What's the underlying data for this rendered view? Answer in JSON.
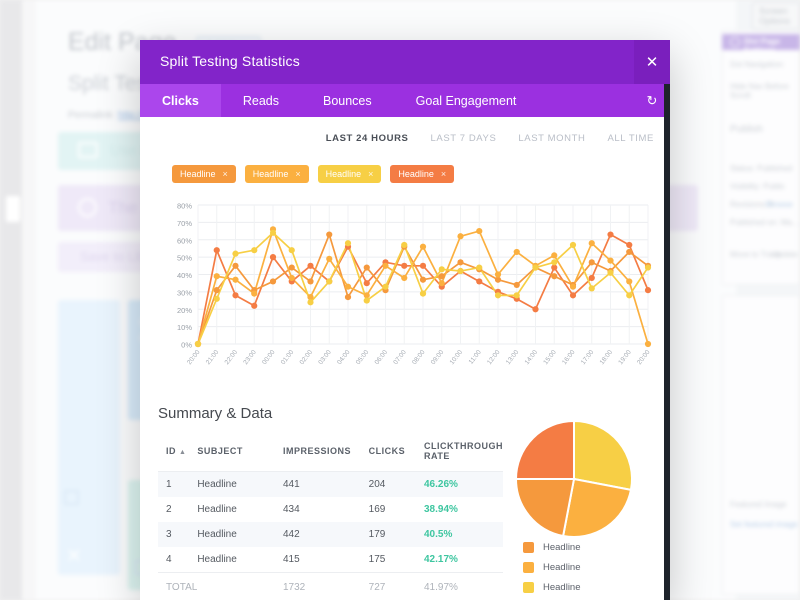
{
  "background": {
    "page_title": "Edit Page",
    "add_new": "Add New",
    "post_title": "Split Test",
    "permalink_label": "Permalink:",
    "permalink_url": "http://10.1.10.10:8888/",
    "use_default_editor": "Use Default Editor",
    "divi_builder": "The Divi Builder",
    "save_to_library": "Save to Library",
    "add_new_module": "Add New",
    "screen_options": "Screen Options",
    "divi_page_settings": "Divi Page Settings",
    "dot_navigation": "Dot Navigation:",
    "hide_nav_before_scroll": "Hide Nav Before Scroll:",
    "publish": "Publish",
    "status_published": "Status: Published",
    "visibility_public": "Visibility: Public",
    "revisions": "Revisions: 8",
    "revisions_link": "Browse",
    "published_on": "Published on: Ma...",
    "move_to_trash": "Move to Trash",
    "update": "Update",
    "featured_image": "Featured Image",
    "set_featured_image": "Set featured image"
  },
  "modal": {
    "title": "Split Testing Statistics",
    "close_icon": "close-icon",
    "refresh_icon": "refresh-icon",
    "tabs": [
      {
        "label": "Clicks",
        "active": true
      },
      {
        "label": "Reads",
        "active": false
      },
      {
        "label": "Bounces",
        "active": false
      },
      {
        "label": "Goal Engagement",
        "active": false
      }
    ],
    "ranges": [
      {
        "label": "LAST 24 HOURS",
        "active": true
      },
      {
        "label": "LAST 7 DAYS",
        "active": false
      },
      {
        "label": "LAST MONTH",
        "active": false
      },
      {
        "label": "ALL TIME",
        "active": false
      }
    ],
    "tags": [
      {
        "label": "Headline",
        "color": "#f5993d",
        "close": "×"
      },
      {
        "label": "Headline",
        "color": "#fbb040",
        "close": "×"
      },
      {
        "label": "Headline",
        "color": "#f7cf45",
        "close": "×"
      },
      {
        "label": "Headline",
        "color": "#f47c44",
        "close": "×"
      }
    ],
    "summary_title": "Summary & Data",
    "table": {
      "sort_arrow": "▲",
      "columns": [
        "ID",
        "SUBJECT",
        "IMPRESSIONS",
        "CLICKS",
        "CLICKTHROUGH RATE"
      ],
      "rows": [
        {
          "id": "1",
          "subject": "Headline",
          "impressions": "441",
          "clicks": "204",
          "ctr": "46.26%"
        },
        {
          "id": "2",
          "subject": "Headline",
          "impressions": "434",
          "clicks": "169",
          "ctr": "38.94%"
        },
        {
          "id": "3",
          "subject": "Headline",
          "impressions": "442",
          "clicks": "179",
          "ctr": "40.5%"
        },
        {
          "id": "4",
          "subject": "Headline",
          "impressions": "415",
          "clicks": "175",
          "ctr": "42.17%"
        }
      ],
      "total": {
        "label": "TOTAL",
        "subject": "",
        "impressions": "1732",
        "clicks": "727",
        "ctr": "41.97%"
      }
    },
    "legend": [
      {
        "label": "Headline",
        "color": "#f5993d"
      },
      {
        "label": "Headline",
        "color": "#fbb040"
      },
      {
        "label": "Headline",
        "color": "#f7cf45"
      }
    ]
  },
  "colors": {
    "brand_purple": "#8224c9",
    "tab_bar_purple": "#9b30e0",
    "tab_active_purple": "#ab46ec",
    "ctr_green": "#3ec6a0",
    "series": [
      "#f47c44",
      "#f5993d",
      "#fbb040",
      "#f7cf45"
    ]
  },
  "chart_data": [
    {
      "type": "line",
      "title": "",
      "xlabel": "",
      "ylabel": "",
      "ylim": [
        0,
        80
      ],
      "yticks": [
        0,
        10,
        20,
        30,
        40,
        50,
        60,
        70,
        80
      ],
      "ytick_labels": [
        "0%",
        "10%",
        "20%",
        "30%",
        "40%",
        "50%",
        "60%",
        "70%",
        "80%"
      ],
      "grid": true,
      "legend": "none",
      "x": [
        "20:00",
        "21:00",
        "22:00",
        "23:00",
        "00:00",
        "01:00",
        "02:00",
        "03:00",
        "04:00",
        "05:00",
        "06:00",
        "07:00",
        "08:00",
        "09:00",
        "10:00",
        "11:00",
        "12:00",
        "13:00",
        "14:00",
        "15:00",
        "16:00",
        "17:00",
        "18:00",
        "19:00",
        "20:00"
      ],
      "series": [
        {
          "name": "Headline",
          "color": "#f47c44",
          "values": [
            0,
            54,
            28,
            22,
            50,
            36,
            45,
            36,
            56,
            35,
            47,
            45,
            45,
            33,
            42,
            36,
            30,
            26,
            20,
            44,
            28,
            38,
            63,
            57,
            31
          ]
        },
        {
          "name": "Headline",
          "color": "#f5993d",
          "values": [
            0,
            31,
            45,
            31,
            36,
            44,
            36,
            63,
            27,
            44,
            31,
            56,
            37,
            39,
            47,
            43,
            37,
            34,
            44,
            39,
            34,
            47,
            42,
            53,
            45
          ]
        },
        {
          "name": "Headline",
          "color": "#fbb040",
          "values": [
            0,
            39,
            37,
            29,
            66,
            38,
            27,
            49,
            33,
            28,
            45,
            38,
            56,
            35,
            62,
            65,
            40,
            53,
            45,
            51,
            33,
            58,
            48,
            36,
            0
          ]
        },
        {
          "name": "Headline",
          "color": "#f7cf45",
          "values": [
            0,
            26,
            52,
            54,
            64,
            54,
            24,
            36,
            58,
            25,
            33,
            57,
            29,
            43,
            42,
            44,
            28,
            28,
            44,
            47,
            57,
            32,
            41,
            28,
            44
          ]
        }
      ]
    },
    {
      "type": "pie",
      "title": "",
      "labels": [
        "Headline",
        "Headline",
        "Headline",
        "Headline"
      ],
      "values": [
        28,
        25,
        22,
        25
      ],
      "colors": [
        "#f7cf45",
        "#fbb040",
        "#f5993d",
        "#f47c44"
      ],
      "legend": "bottom"
    }
  ]
}
